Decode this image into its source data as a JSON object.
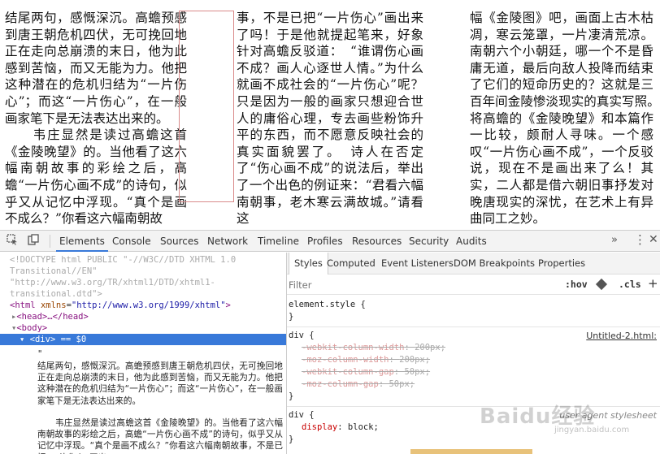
{
  "page": {
    "col1": [
      "结尾两句，感慨深沉。高蟾预感到唐王朝危机四伏，无可挽回地正在走向总崩溃的末日，他为此感到苦恼，而又无能为力。他把这种潜在的危机归结为“一片伤心”；而这“一片伤心”，在一般画家笔下是无法表达出来的。",
      "　　韦庄显然是读过高蟾这首《金陵晚望》的。当他看了这六幅南朝故事的彩绘之后，高蟾“一片伤心画不成”的诗句，似乎又从记忆中浮现。“真个是画不成么？”你看这六幅南朝故"
    ],
    "col2": [
      "事，不是已把“一片伤心”画出来了吗！于是他就提起笔来，好象针对高蟾反驳道：　“谁谓伤心画不成？画人心逐世人情。”为什么就画不成社会的“一片伤心”呢？只是因为一般的画家只想迎合世人的庸俗心理，专去画些粉饰升平的东西，而不愿意反映社会的真实面貌罢了。　诗人在否定了“伤心画不成”的说法后，举出了一个出色的例证来：“君看六幅南朝事，老木寒云满故城。”请看这"
    ],
    "col3": [
      "幅《金陵图》吧，画面上古木枯凋，寒云笼罩，一片凄清荒凉。南朝六个小朝廷，哪一个不是昏庸无道，最后向敌人投降而结束了它们的短命历史的？这就是三百年间金陵惨淡现实的真实写照。　将高蟾的《金陵晚望》和本篇作一比较，颇耐人寻味。一个感叹“一片伤心画不成”，一个反驳说，现在不是画出来了么！其实，二人都是借六朝旧事抒发对晚唐现实的深忧，在艺术上有异曲同工之妙。"
    ]
  },
  "devtools": {
    "tabs": [
      "Elements",
      "Console",
      "Sources",
      "Network",
      "Timeline",
      "Profiles",
      "Resources",
      "Security",
      "Audits"
    ],
    "active_tab": "Elements",
    "icons": [
      "inspect-icon",
      "device-mode-icon",
      "more-tabs-icon",
      "kebab-menu-icon",
      "close-icon"
    ],
    "elements": {
      "doctype_1": "<!DOCTYPE html PUBLIC \"-//W3C//DTD XHTML 1.0",
      "doctype_2": "Transitional//EN\"",
      "doctype_3": "\"http://www.w3.org/TR/xhtml1/DTD/xhtml1-",
      "doctype_4": "transitional.dtd\">",
      "html_tag": "html",
      "html_attr": "xmlns",
      "html_val": "\"http://www.w3.org/1999/xhtml\"",
      "head_line": "<head>…</head>",
      "body_line": "<body>",
      "div_line": "<div>",
      "div_suffix": "== $0",
      "quote_mark": "\"",
      "text_1": "结尾两句，感慨深沉。高蟾预感到唐王朝危机四伏，无可挽回地正在走向总崩溃的末日，他为此感到苦恼，而又无能为力。他把这种潜在的危机归结为“一片伤心”；而这“一片伤心”，在一般画家笔下是无法表达出来的。",
      "text_2": "韦庄显然是读过高蟾这首《金陵晚望》的。当他看了这六幅南朝故事的彩绘之后，高蟾“一片伤心画不成”的诗句，似乎又从记忆中浮现。“真个是画不成么？”你看这六幅南朝故事，不是已把“一片伤心”画出"
    },
    "styles": {
      "tabs": [
        "Styles",
        "Computed",
        "Event Listeners",
        "DOM Breakpoints",
        "Properties"
      ],
      "active_tab": "Styles",
      "filter_placeholder": "Filter",
      "hov": ":hov",
      "cls": ".cls",
      "plus": "+",
      "element_style": "element.style {",
      "close_brace": "}",
      "div_rule": "div {",
      "div_source": "Untitled-2.html:",
      "prop_1_name": "-webkit-column-width",
      "prop_1_val": "200px;",
      "prop_2_name": "-moz-column-width",
      "prop_2_val": "200px;",
      "prop_3_name": "-webkit-column-gap",
      "prop_3_val": "50px;",
      "prop_4_name": "-moz-column-gap",
      "prop_4_val": "50px;",
      "ua_rule": "div {",
      "ua_source": "user agent stylesheet",
      "ua_prop_name": "display",
      "ua_prop_val": "block;"
    }
  },
  "watermark": {
    "text": "Baidu经验",
    "sub": "jingyan.baidu.com"
  }
}
